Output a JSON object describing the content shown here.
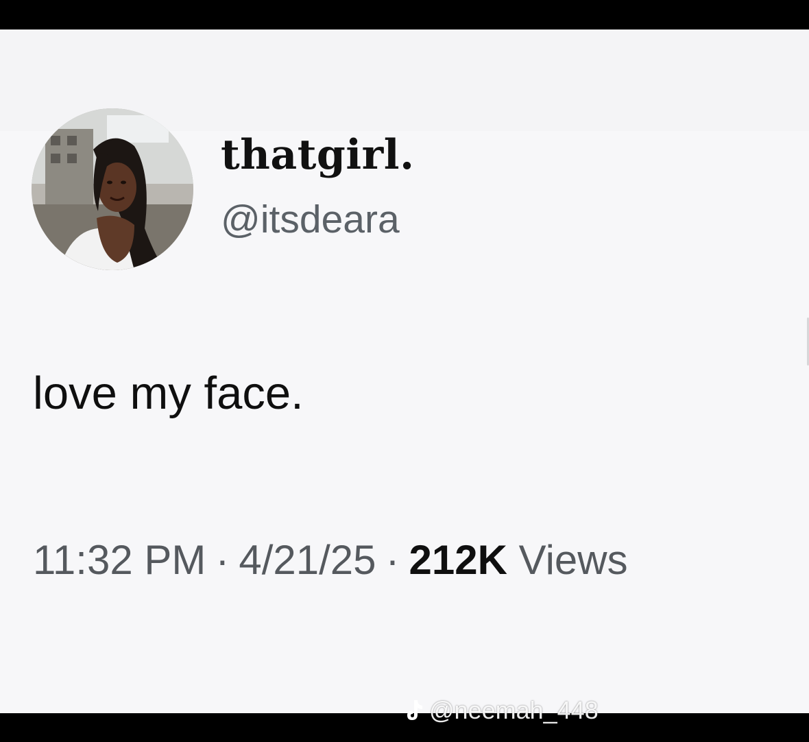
{
  "tweet": {
    "display_name": "thatgirl.",
    "handle": "@itsdeara",
    "text": "love my face.",
    "time": "11:32 PM",
    "date": "4/21/25",
    "views_count": "212K",
    "views_label": "Views",
    "separator": "·"
  },
  "watermark": {
    "icon": "tiktok-icon",
    "text": "@neemah_448"
  },
  "colors": {
    "card_background": "#f7f7f9",
    "frame": "#000000",
    "handle": "#5b6167",
    "text": "#0f0f0f"
  }
}
